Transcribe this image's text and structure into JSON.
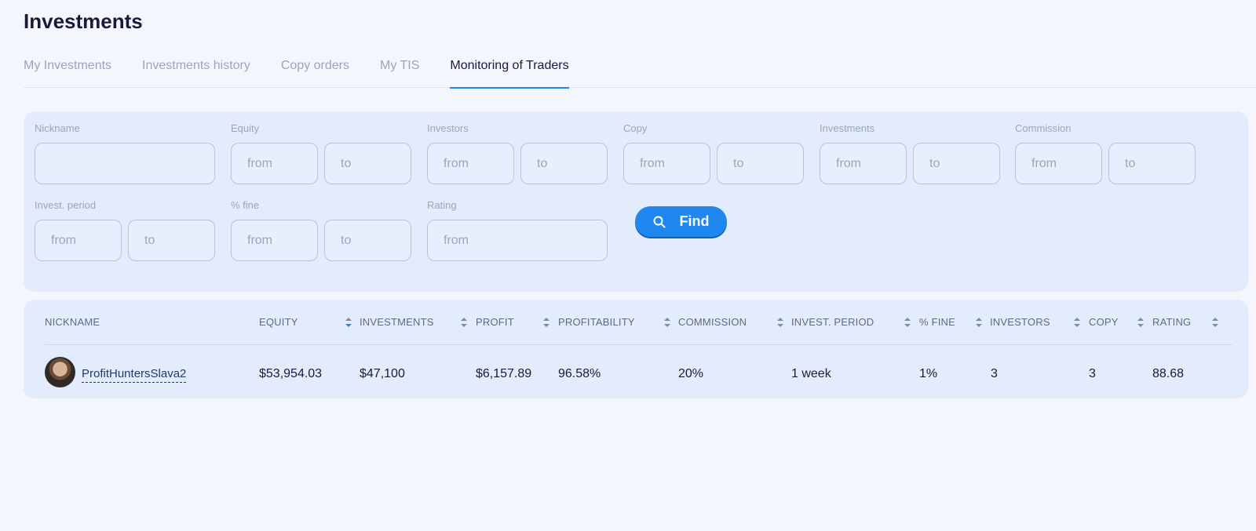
{
  "page": {
    "title": "Investments"
  },
  "tabs": [
    {
      "label": "My Investments"
    },
    {
      "label": "Investments history"
    },
    {
      "label": "Copy orders"
    },
    {
      "label": "My TIS"
    },
    {
      "label": "Monitoring of Traders"
    }
  ],
  "filters": {
    "nickname": {
      "label": "Nickname",
      "value": ""
    },
    "equity": {
      "label": "Equity",
      "from": "from",
      "to": "to"
    },
    "investors": {
      "label": "Investors",
      "from": "from",
      "to": "to"
    },
    "copy": {
      "label": "Copy",
      "from": "from",
      "to": "to"
    },
    "investments": {
      "label": "Investments",
      "from": "from",
      "to": "to"
    },
    "commission": {
      "label": "Commission",
      "from": "from",
      "to": "to"
    },
    "invest_period": {
      "label": "Invest. period",
      "from": "from",
      "to": "to"
    },
    "fine": {
      "label": "% fine",
      "from": "from",
      "to": "to"
    },
    "rating": {
      "label": "Rating",
      "from": "from"
    },
    "find_label": "Find"
  },
  "table": {
    "headers": {
      "nickname": "NICKNAME",
      "equity": "EQUITY",
      "investments": "INVESTMENTS",
      "profit": "PROFIT",
      "profitability": "PROFITABILITY",
      "commission": "COMMISSION",
      "invest_period": "INVEST. PERIOD",
      "fine": "% FINE",
      "investors": "INVESTORS",
      "copy": "COPY",
      "rating": "RATING"
    },
    "rows": [
      {
        "nickname": "ProfitHuntersSlava2",
        "equity": "$53,954.03",
        "investments": "$47,100",
        "profit": "$6,157.89",
        "profitability": "96.58%",
        "commission": "20%",
        "invest_period": "1 week",
        "fine": "1%",
        "investors": "3",
        "copy": "3",
        "rating": "88.68"
      }
    ]
  },
  "colors": {
    "accent": "#1e88f0",
    "panel": "#e3ecfc",
    "background": "#f3f7fd"
  }
}
